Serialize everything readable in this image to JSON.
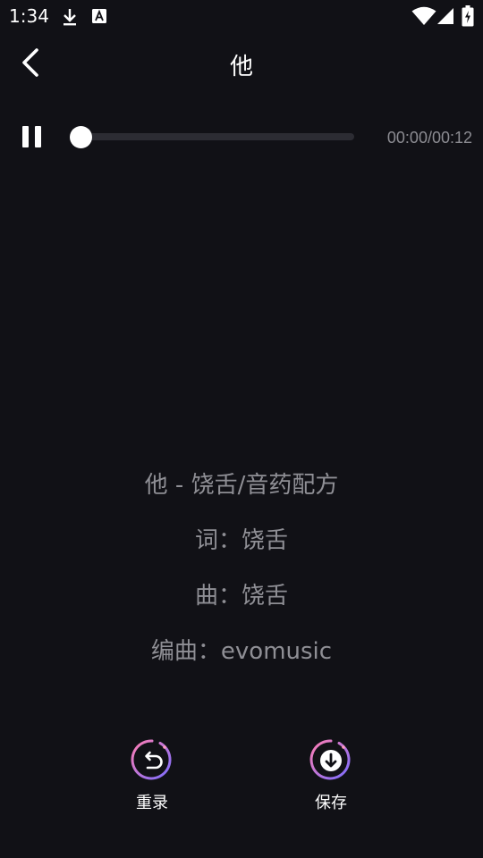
{
  "status_bar": {
    "time": "1:34",
    "icons": [
      "download-icon",
      "a-badge-icon",
      "wifi-icon",
      "signal-icon",
      "battery-charging-icon"
    ]
  },
  "header": {
    "title": "他",
    "back_icon": "chevron-left-icon"
  },
  "player": {
    "state_icon": "pause-icon",
    "time_text": "00:00/00:12",
    "progress": 0
  },
  "lyrics": {
    "lines": [
      "他 - 饶舌/音药配方",
      "词：饶舌",
      "曲：饶舌",
      "编曲：evomusic"
    ]
  },
  "actions": {
    "rerecord_label": "重录",
    "save_label": "保存",
    "rerecord_icon": "undo-icon",
    "save_icon": "download-arrow-icon"
  },
  "colors": {
    "background": "#111116",
    "lyric_text": "#8f8f95",
    "time_text": "#8c8c92",
    "ring_gradient_start": "#ff7eb3",
    "ring_gradient_end": "#7b6cff"
  }
}
